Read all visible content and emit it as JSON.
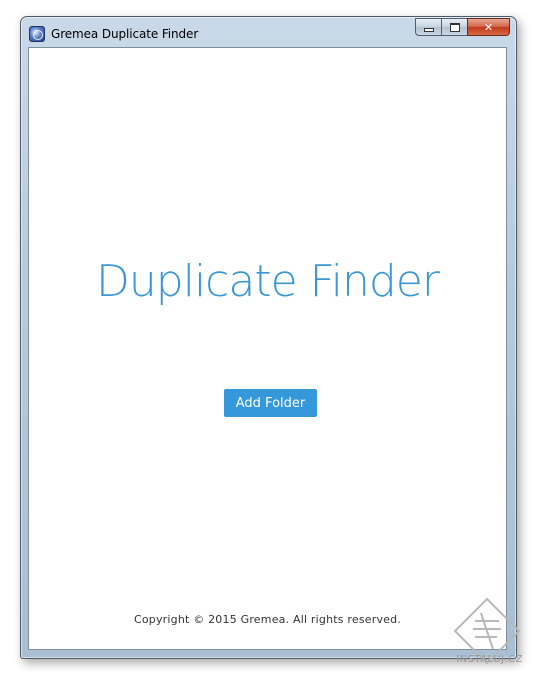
{
  "window": {
    "title": "Gremea Duplicate Finder",
    "app_icon": "gremea-app-icon",
    "caption_buttons": {
      "minimize_icon": "minimize-icon",
      "maximize_icon": "maximize-icon",
      "close_label": "✕"
    }
  },
  "main": {
    "heading": "Duplicate Finder",
    "add_folder_label": "Add Folder",
    "copyright": "Copyright © 2015 Gremea. All rights reserved."
  },
  "watermark": {
    "text": "INSTALUJ.CZ"
  },
  "colors": {
    "accent": "#3598db",
    "heading": "#3a97d4",
    "close_button": "#c0391b"
  }
}
